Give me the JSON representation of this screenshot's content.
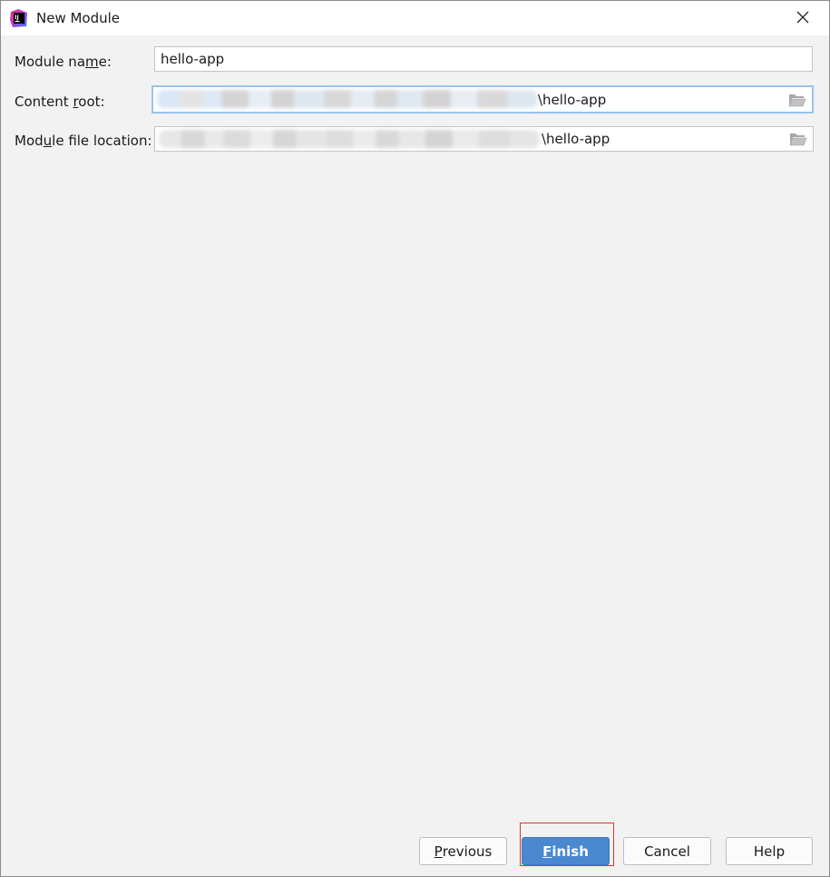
{
  "window": {
    "title": "New Module",
    "app_icon": "intellij-idea-icon",
    "close_icon": "close-icon"
  },
  "form": {
    "module_name": {
      "label_pre": "Module na",
      "label_mnemonic": "m",
      "label_post": "e:",
      "value": "hello-app"
    },
    "content_root": {
      "label_pre": "Content ",
      "label_mnemonic": "r",
      "label_post": "oot:",
      "value": "\\hello-app",
      "browse_icon": "folder-open-icon"
    },
    "module_file_location": {
      "label_pre": "Mod",
      "label_mnemonic": "u",
      "label_post": "le file location:",
      "value": "\\hello-app",
      "browse_icon": "folder-open-icon"
    }
  },
  "buttons": {
    "previous": {
      "mnemonic": "P",
      "rest": "revious"
    },
    "finish": {
      "mnemonic": "F",
      "rest": "inish"
    },
    "cancel": "Cancel",
    "help": "Help"
  },
  "colors": {
    "accent": "#4a88cf",
    "focus_border": "#97c3ee",
    "annotation": "#e0322e"
  }
}
